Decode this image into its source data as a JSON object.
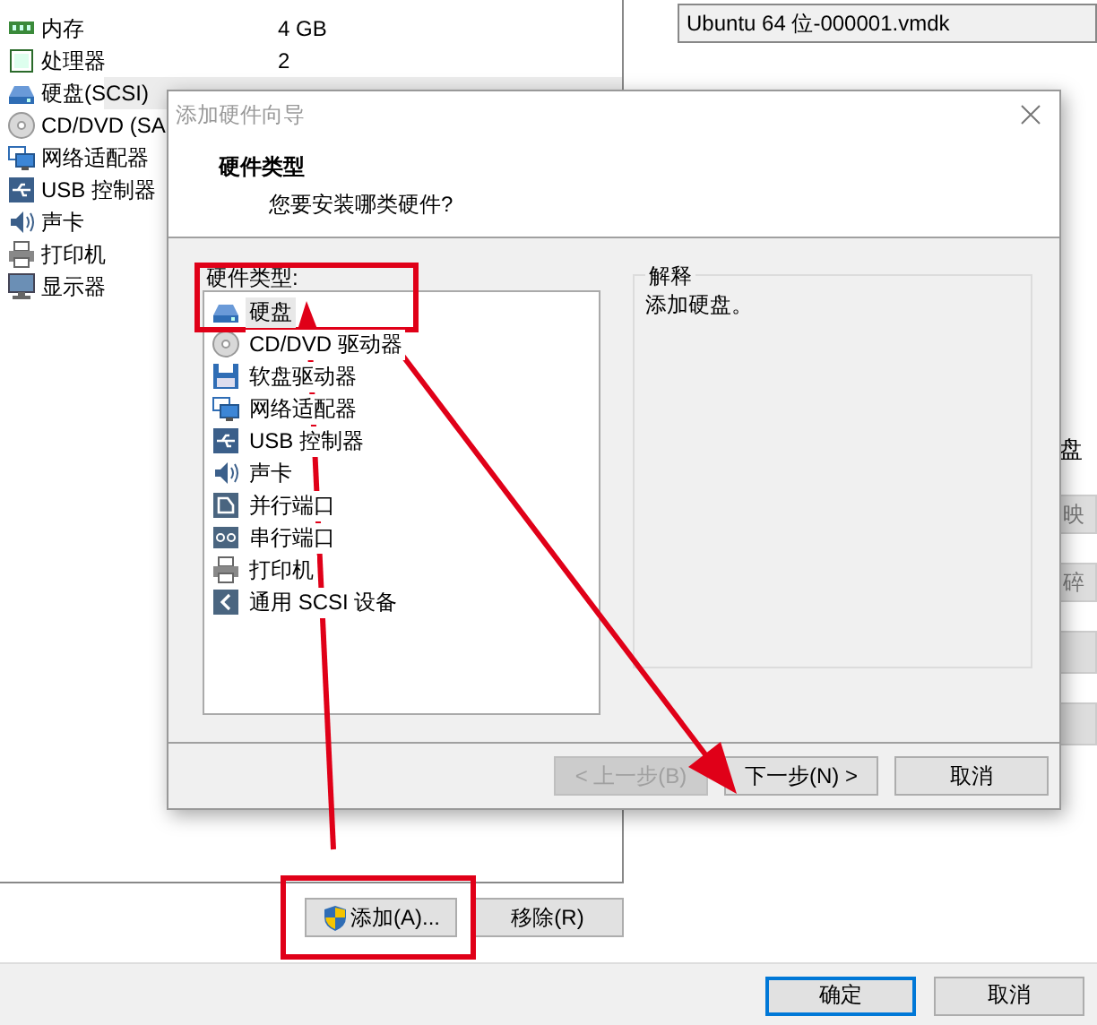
{
  "devices": [
    {
      "name": "内存",
      "value": "4 GB",
      "kind": "memory",
      "selected": false
    },
    {
      "name": "处理器",
      "value": "2",
      "kind": "cpu",
      "selected": false
    },
    {
      "name": "硬盘(SCSI)",
      "kind": "disk",
      "selected": true
    },
    {
      "name": "CD/DVD (SA",
      "kind": "cd",
      "selected": false
    },
    {
      "name": "网络适配器",
      "kind": "network",
      "selected": false
    },
    {
      "name": "USB 控制器",
      "kind": "usb",
      "selected": false
    },
    {
      "name": "声卡",
      "kind": "sound",
      "selected": false
    },
    {
      "name": "打印机",
      "kind": "printer",
      "selected": false
    },
    {
      "name": "显示器",
      "kind": "monitor",
      "selected": false
    }
  ],
  "disk_file": {
    "value": "Ubuntu 64 位-000001.vmdk"
  },
  "side_text": "盘",
  "side_buttons": [
    "映",
    "碎"
  ],
  "device_buttons": [
    "添加(A)...",
    "移除(R)"
  ],
  "footer_buttons": [
    {
      "label": "确定",
      "default": true
    },
    {
      "label": "取消",
      "default": false
    }
  ],
  "dialog": {
    "title": "添加硬件向导",
    "heading": "硬件类型",
    "subheading": "您要安装哪类硬件?",
    "list_label": "硬件类型:",
    "items": [
      {
        "label": "硬盘",
        "kind": "disk",
        "selected": true
      },
      {
        "label": "CD/DVD 驱动器",
        "kind": "cd",
        "selected": false
      },
      {
        "label": "软盘驱动器",
        "kind": "floppy",
        "selected": false
      },
      {
        "label": "网络适配器",
        "kind": "network",
        "selected": false
      },
      {
        "label": "USB 控制器",
        "kind": "usb",
        "selected": false
      },
      {
        "label": "声卡",
        "kind": "sound",
        "selected": false
      },
      {
        "label": "并行端口",
        "kind": "parallel",
        "selected": false
      },
      {
        "label": "串行端口",
        "kind": "serial",
        "selected": false
      },
      {
        "label": "打印机",
        "kind": "printer",
        "selected": false
      },
      {
        "label": "通用 SCSI 设备",
        "kind": "scsi",
        "selected": false
      }
    ],
    "explanation_title": "解释",
    "explanation": "添加硬盘。",
    "buttons": [
      {
        "label": "< 上一步(B)",
        "disabled": true
      },
      {
        "label": "下一步(N) >",
        "disabled": false
      },
      {
        "label": "取消",
        "disabled": false
      }
    ]
  }
}
